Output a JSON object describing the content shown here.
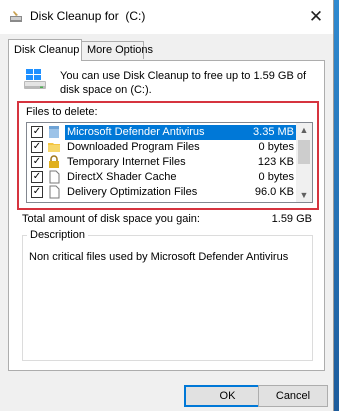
{
  "window": {
    "title": "Disk Cleanup for  (C:)",
    "title_icon": "disk-cleanup-icon",
    "close_glyph": "✕"
  },
  "tabs": [
    {
      "label": "Disk Cleanup",
      "active": true
    },
    {
      "label": "More Options",
      "active": false
    }
  ],
  "intro": {
    "icon": "drive-icon",
    "text": "You can use Disk Cleanup to free up to 1.59 GB of disk space on  (C:)."
  },
  "files": {
    "label": "Files to delete:",
    "items": [
      {
        "name": "Microsoft Defender Antivirus",
        "size": "3.35 MB",
        "checked": true,
        "selected": true,
        "icon": "folder-blue-icon"
      },
      {
        "name": "Downloaded Program Files",
        "size": "0 bytes",
        "checked": true,
        "selected": false,
        "icon": "folder-icon"
      },
      {
        "name": "Temporary Internet Files",
        "size": "123 KB",
        "checked": true,
        "selected": false,
        "icon": "lock-icon"
      },
      {
        "name": "DirectX Shader Cache",
        "size": "0 bytes",
        "checked": true,
        "selected": false,
        "icon": "file-icon"
      },
      {
        "name": "Delivery Optimization Files",
        "size": "96.0 KB",
        "checked": true,
        "selected": false,
        "icon": "file-icon"
      }
    ],
    "check_glyph": "✓"
  },
  "total": {
    "label": "Total amount of disk space you gain:",
    "value": "1.59 GB"
  },
  "description": {
    "legend": "Description",
    "text": "Non critical files used by Microsoft Defender Antivirus"
  },
  "buttons": {
    "ok": "OK",
    "cancel": "Cancel"
  },
  "colors": {
    "selection": "#0078d7",
    "highlight_border": "#d6343f",
    "desktop": "#1f6fb6"
  }
}
